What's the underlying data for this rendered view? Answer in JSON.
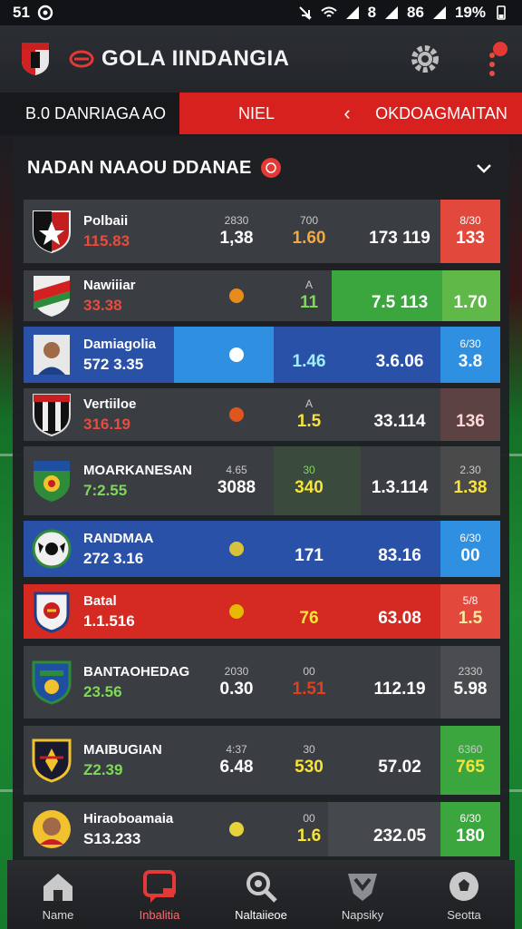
{
  "status_bar": {
    "time": "51",
    "battery": "19%",
    "signal_text": "8",
    "signal_text2": "86"
  },
  "app": {
    "title": "GOLA IINDANGIA"
  },
  "tabs": {
    "left": "B.0 DANRIAGA AO",
    "middle": "NIEL",
    "right": "OKDOAGMAITAN"
  },
  "section": {
    "title": "NADAN NAAOU DDANAE",
    "badge": ""
  },
  "rows": [
    {
      "name": "Polbaii",
      "sub": "115.83",
      "c1_small": "2830",
      "c1": "1,38",
      "c2_small": "700",
      "c2": "1.60",
      "c3": "173 119",
      "c4_small": "8/30",
      "c4": "133"
    },
    {
      "name": "Nawiiiar",
      "sub": "33.38",
      "c1_small": "",
      "c1": "",
      "c2_small": "A",
      "c2": "11",
      "c3": "7.5 113",
      "c4_small": "",
      "c4": "1.70"
    },
    {
      "name": "Damiagolia",
      "sub": "572 3.35",
      "c1_small": "",
      "c1": "",
      "c2_small": "",
      "c2": "1.46",
      "c3": "3.6.06",
      "c4_small": "6/30",
      "c4": "3.8"
    },
    {
      "name": "Vertiiloe",
      "sub": "316.19",
      "c1_small": "",
      "c1": "",
      "c2_small": "A",
      "c2": "1.5",
      "c3": "33.114",
      "c4_small": "",
      "c4": "136"
    },
    {
      "name": "MOARKANESAN",
      "sub": "7:2.55",
      "c1_small": "4.65",
      "c1": "3088",
      "c2_small": "30",
      "c2": "340",
      "c3": "1.3.114",
      "c4_small": "2.30",
      "c4": "1.38"
    },
    {
      "name": "RANDMAA",
      "sub": "272 3.16",
      "c1_small": "",
      "c1": "",
      "c2_small": "",
      "c2": "171",
      "c3": "83.16",
      "c4_small": "6/30",
      "c4": "00"
    },
    {
      "name": "Batal",
      "sub": "1.1.516",
      "c1_small": "",
      "c1": "",
      "c2_small": "",
      "c2": "76",
      "c3": "63.08",
      "c4_small": "5/8",
      "c4": "1.5"
    },
    {
      "name": "BANTAOHEDAG",
      "sub": "23.56",
      "c1_small": "2030",
      "c1": "0.30",
      "c2_small": "00",
      "c2": "1.51",
      "c3": "112.19",
      "c4_small": "2330",
      "c4": "5.98"
    },
    {
      "name": "MAIBUGIAN",
      "sub": "Z2.39",
      "c1_small": "4:37",
      "c1": "6.48",
      "c2_small": "30",
      "c2": "530",
      "c3": "57.02",
      "c4_small": "6360",
      "c4": "765"
    },
    {
      "name": "Hiraoboamaia",
      "sub": "S13.233",
      "c1_small": "",
      "c1": "",
      "c2_small": "00",
      "c2": "1.6",
      "c3": "232.05",
      "c4_small": "6/30",
      "c4": "180"
    }
  ],
  "nav": [
    {
      "label": "Name",
      "icon": "home-icon"
    },
    {
      "label": "Inbalitia",
      "icon": "chat-icon"
    },
    {
      "label": "Naltaiieoe",
      "icon": "search-ball-icon"
    },
    {
      "label": "Napsiky",
      "icon": "shield-icon"
    },
    {
      "label": "Seotta",
      "icon": "ball-icon"
    }
  ],
  "colors": {
    "accent_red": "#d7211f",
    "blue": "#2a51a8",
    "green": "#3aa63d",
    "panel": "#1e2024"
  }
}
